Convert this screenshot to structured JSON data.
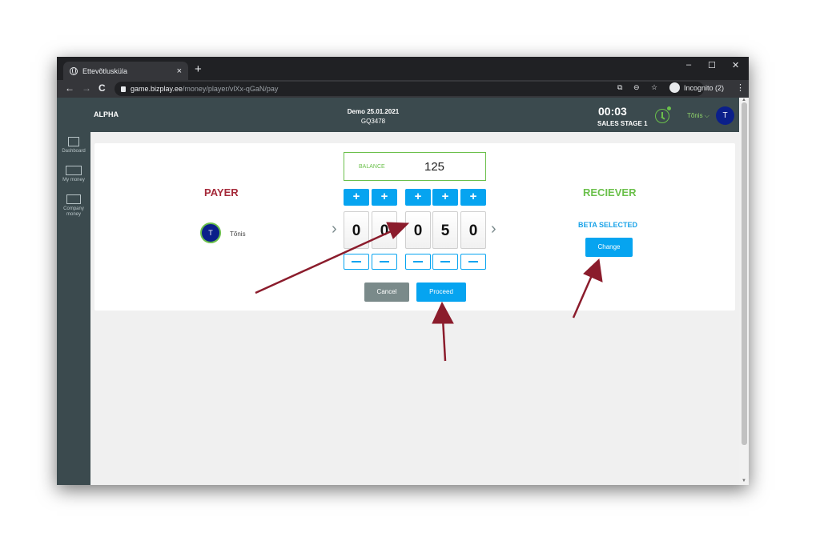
{
  "browser": {
    "tab_title": "Ettevõtlusküla",
    "tab_close": "×",
    "new_tab": "+",
    "win_minimize": "–",
    "win_maximize": "☐",
    "win_close": "✕",
    "back": "←",
    "forward": "→",
    "reload": "C",
    "url_host": "game.bizplay.ee",
    "url_path": "/money/player/vlXx-qGaN/pay",
    "incognito_label": "Incognito (2)",
    "menu": "⋮"
  },
  "header": {
    "brand": "ALPHA",
    "demo_title": "Demo 25.01.2021",
    "demo_code": "GQ3478",
    "timer": "00:03",
    "stage": "SALES STAGE 1",
    "user_name": "Tõnis ⌵",
    "user_initial": "T"
  },
  "sidebar": {
    "items": [
      {
        "label": "Dashboard",
        "icon": "dashboard-icon"
      },
      {
        "label": "My money",
        "icon": "money-icon"
      },
      {
        "label": "Company money",
        "icon": "company-money-icon"
      }
    ]
  },
  "pay": {
    "balance_label": "BALANCE",
    "balance_value": "125",
    "payer_title": "PAYER",
    "payer_initial": "T",
    "payer_name": "Tõnis",
    "receiver_title": "RECIEVER",
    "receiver_status": "BETA SELECTED",
    "change_label": "Change",
    "plus_label": "+",
    "digits": [
      "0",
      "0",
      "0",
      "5",
      "0"
    ],
    "chevron_left": "›",
    "chevron_right": "›",
    "cancel_label": "Cancel",
    "proceed_label": "Proceed"
  },
  "colors": {
    "header_bg": "#3b4a4e",
    "accent_blue": "#06a4f0",
    "accent_green": "#6bc04b",
    "payer_red": "#a52a3a",
    "annotation_arrow": "#8b1c2c"
  }
}
